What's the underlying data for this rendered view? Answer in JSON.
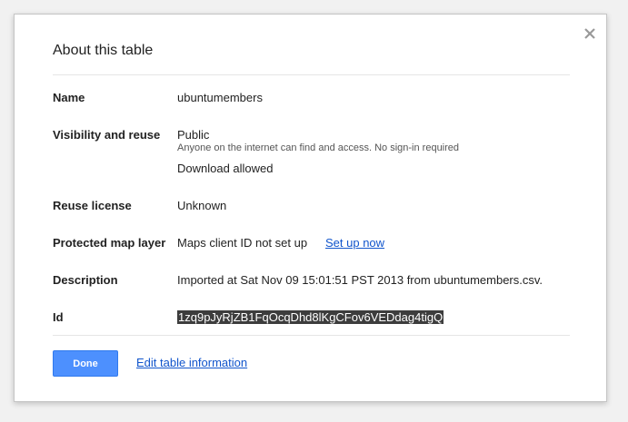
{
  "dialog": {
    "title": "About this table",
    "close_icon": "close-icon",
    "rows": {
      "name": {
        "label": "Name",
        "value": "ubuntumembers"
      },
      "visibility": {
        "label": "Visibility and reuse",
        "value": "Public",
        "note": "Anyone on the internet can find and access. No sign-in required",
        "download": "Download allowed"
      },
      "license": {
        "label": "Reuse license",
        "value": "Unknown"
      },
      "map_layer": {
        "label": "Protected map layer",
        "value": "Maps client ID not set up",
        "link": "Set up now"
      },
      "description": {
        "label": "Description",
        "value": "Imported at Sat Nov 09 15:01:51 PST 2013 from ubuntumembers.csv."
      },
      "id": {
        "label": "Id",
        "value": "1zq9pJyRjZB1FqOcqDhd8lKgCFov6VEDdag4tigQ"
      }
    },
    "done_label": "Done",
    "edit_label": "Edit table information"
  },
  "colors": {
    "primary_button": "#4d90fe",
    "link": "#1155cc",
    "selection": "#3d3d3d"
  }
}
